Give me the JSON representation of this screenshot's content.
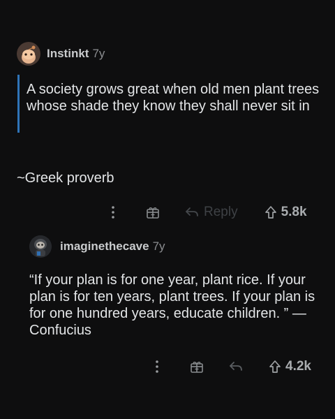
{
  "comments": [
    {
      "username": "Instinkt",
      "age": "7y",
      "body_quote": "A society grows great when old men plant trees whose shade they know they shall never sit in",
      "body_text": "~Greek proverb",
      "actions": {
        "more_icon": "vertical-ellipsis-icon",
        "award_icon": "gift-award-icon",
        "reply_icon": "reply-arrow-icon",
        "reply_label": "Reply",
        "upvote_icon": "upvote-arrow-icon",
        "score": "5.8k"
      }
    },
    {
      "username": "imaginethecave",
      "age": "7y",
      "body_text": "“If your plan is for one year, plant rice. If your plan is for ten years, plant trees. If your plan is for one hundred years, educate children. ” — Confucius",
      "actions": {
        "more_icon": "vertical-ellipsis-icon",
        "award_icon": "gift-award-icon",
        "reply_icon": "reply-arrow-icon",
        "upvote_icon": "upvote-arrow-icon",
        "score": "4.2k"
      }
    }
  ],
  "colors": {
    "background": "#0e0e0f",
    "quote_bar": "#2f74b8",
    "text": "#e3e5e7",
    "muted": "#8b8d90"
  }
}
